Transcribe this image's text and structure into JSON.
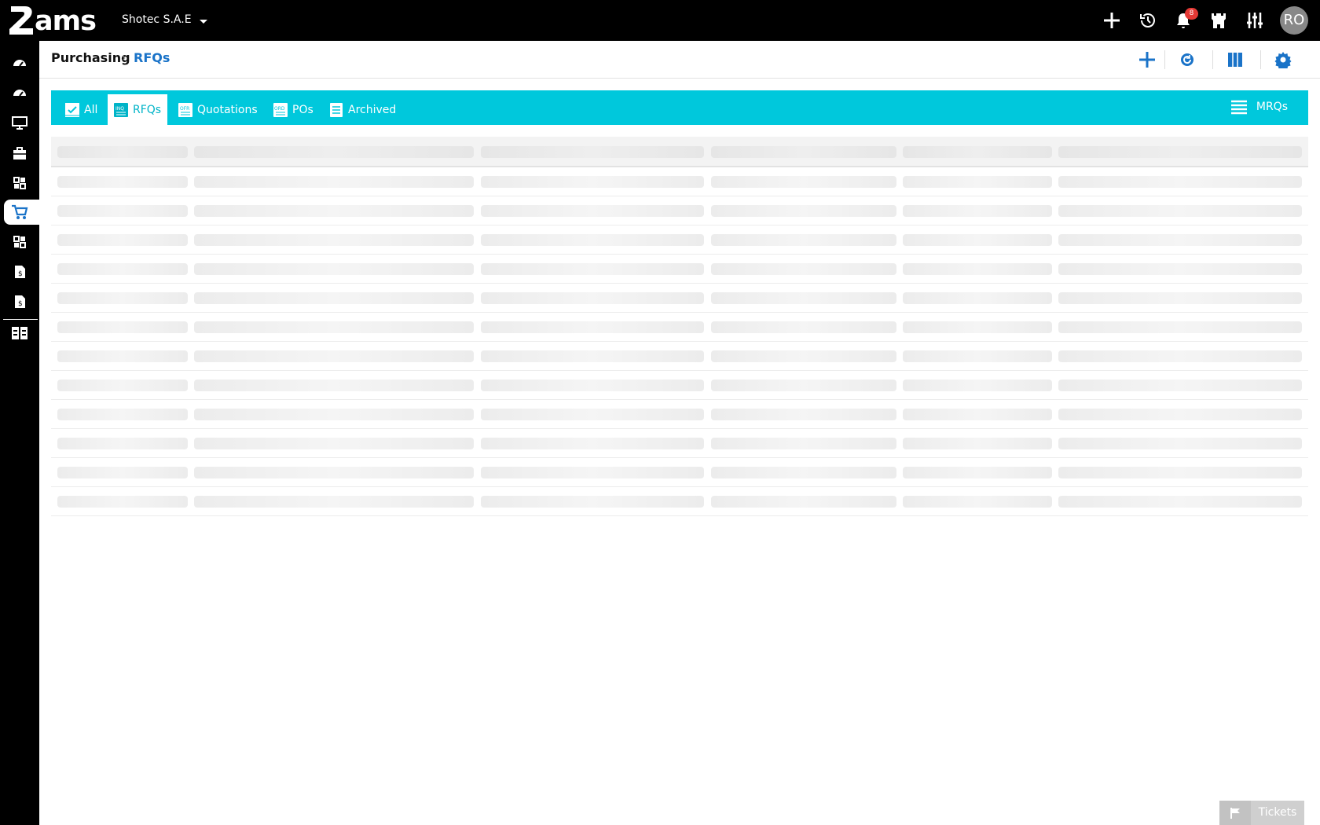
{
  "app": {
    "logo_text": "ams",
    "company": "Shotec S.A.E"
  },
  "topbar": {
    "notification_count": "8",
    "user_initials": "RO"
  },
  "breadcrumb": {
    "root": "Purchasing",
    "separator": "›",
    "current": "RFQs"
  },
  "tabs": [
    {
      "label": "All",
      "icon": "checkbox-icon",
      "active": false
    },
    {
      "label": "RFQs",
      "icon": "inq-doc-icon",
      "active": true
    },
    {
      "label": "Quotations",
      "icon": "ofr-doc-icon",
      "active": false
    },
    {
      "label": "POs",
      "icon": "ord-doc-icon",
      "active": false
    },
    {
      "label": "Archived",
      "icon": "archive-icon",
      "active": false
    }
  ],
  "mrq_link": "MRQs",
  "tickets": {
    "label": "Tickets"
  },
  "colors": {
    "accent": "#00c8dc",
    "link_blue": "#1a73c8",
    "topbar": "#000000",
    "badge": "#e53935"
  }
}
